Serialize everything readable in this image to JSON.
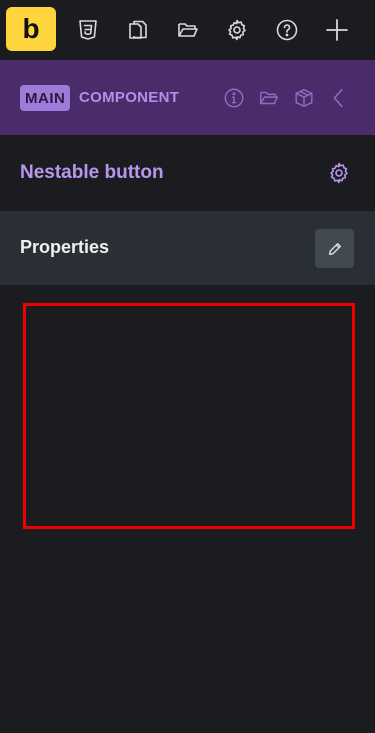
{
  "topbar": {
    "logo_letter": "b",
    "icons": [
      "css3-icon",
      "pages-icon",
      "folder-icon",
      "settings-gear-icon",
      "help-icon",
      "add-plus-icon"
    ]
  },
  "component_header": {
    "badge": "MAIN",
    "label": "COMPONENT",
    "icons": [
      "info-icon",
      "folder-open-icon",
      "box-3d-icon",
      "chevron-left-icon"
    ]
  },
  "panel": {
    "title": "Nestable button",
    "section_label": "Properties"
  },
  "colors": {
    "background": "#1a1c1f",
    "accent_yellow": "#ffd53e",
    "header_purple": "#4a2c6b",
    "title_purple": "#b896f0",
    "properties_bg": "#2a2f36",
    "selection_red": "#f00000"
  }
}
